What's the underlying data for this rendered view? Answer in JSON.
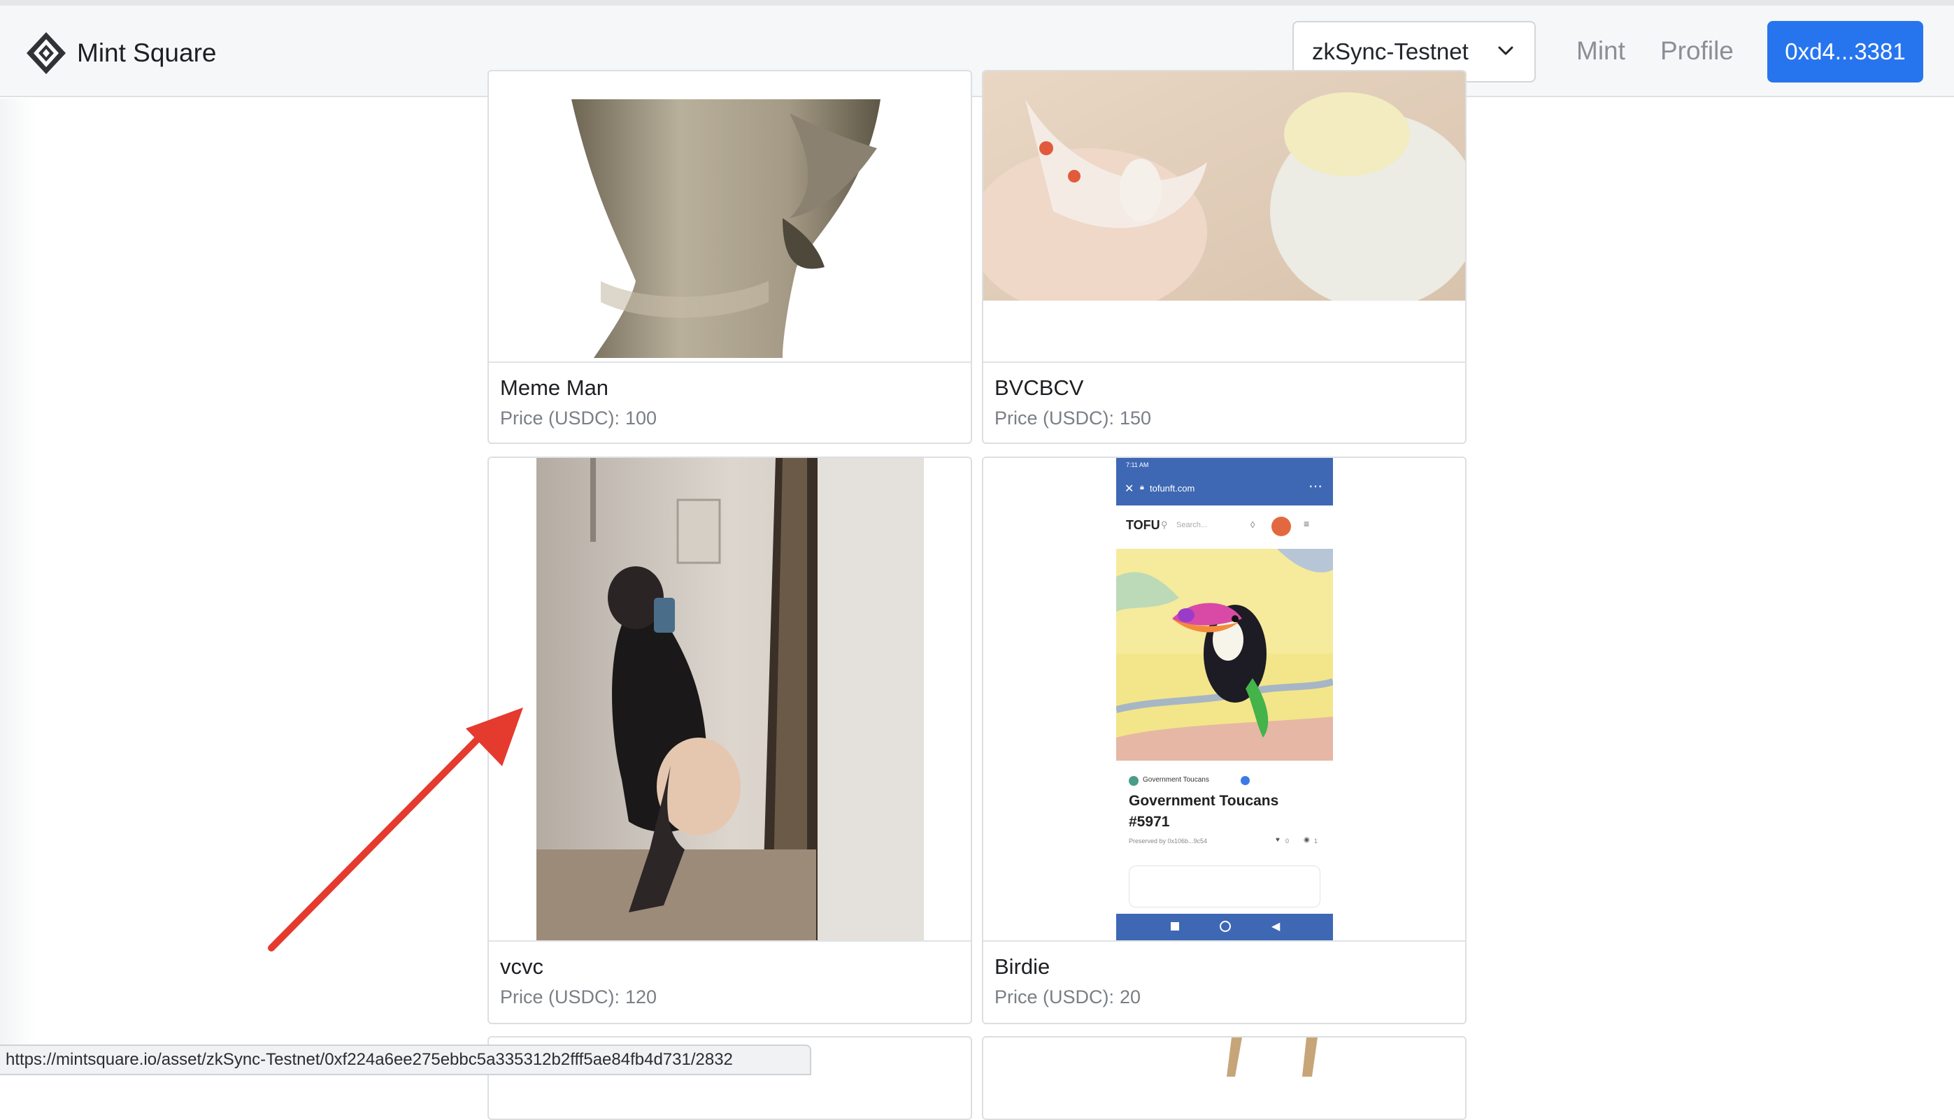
{
  "app": {
    "brand_name": "Mint Square",
    "logo_icon": "diamond-logo-icon"
  },
  "header": {
    "network_select": {
      "selected": "zkSync-Testnet"
    },
    "nav": {
      "mint_label": "Mint",
      "profile_label": "Profile"
    },
    "wallet_label": "0xd4...3381"
  },
  "cards": [
    {
      "title": "Meme Man",
      "price_label": "Price (USDC):",
      "price": "100",
      "image": "bust-sculpture-image"
    },
    {
      "title": "BVCBCV",
      "price_label": "Price (USDC):",
      "price": "150",
      "image": "photo-image"
    },
    {
      "title": "vcvc",
      "price_label": "Price (USDC):",
      "price": "120",
      "image": "mirror-selfie-image"
    },
    {
      "title": "Birdie",
      "price_label": "Price (USDC):",
      "price": "20",
      "image": "toucan-screenshot-image"
    }
  ],
  "phone_screenshot": {
    "status_time": "7:11 AM",
    "url": "tofunft.com",
    "brand": "TOFU",
    "search_placeholder": "Search...",
    "collection": "Government Toucans",
    "nft_name_line1": "Government Toucans",
    "nft_name_line2": "#5971",
    "preserved_by": "Preserved by 0x106b...9c54",
    "likes": "0",
    "views": "1"
  },
  "status_bar": {
    "url": "https://mintsquare.io/asset/zkSync-Testnet/0xf224a6ee275ebbc5a335312b2fff5ae84fb4d731/2832"
  },
  "colors": {
    "accent": "#2775ee",
    "annotation_arrow": "#e53a2e"
  }
}
